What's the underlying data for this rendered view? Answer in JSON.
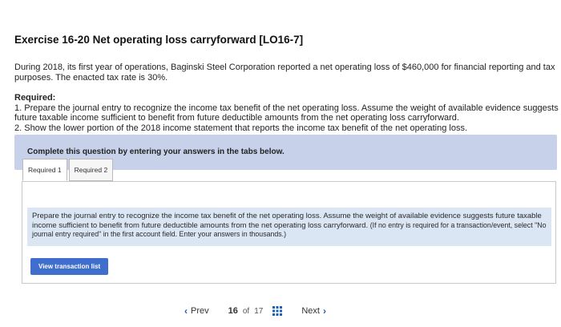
{
  "exercise": {
    "title": "Exercise 16-20 Net operating loss carryforward [LO16-7]",
    "intro": "During 2018, its first year of operations, Baginski Steel Corporation reported a net operating loss of $460,000 for financial reporting and tax purposes. The enacted tax rate is 30%.",
    "required_label": "Required:",
    "requirement_1": "1. Prepare the journal entry to recognize the income tax benefit of the net operating loss. Assume the weight of available evidence suggests future taxable income sufficient to benefit from future deductible amounts from the net operating loss carryforward.",
    "requirement_2": "2. Show the lower portion of the 2018 income statement that reports the income tax benefit of the net operating loss."
  },
  "banner": {
    "text": "Complete this question by entering your answers in the tabs below."
  },
  "tabs": [
    {
      "label": "Required 1",
      "active": true
    },
    {
      "label": "Required 2",
      "active": false
    }
  ],
  "instruction": {
    "text": "Prepare the journal entry to recognize the income tax benefit of the net operating loss. Assume the weight of available evidence suggests future taxable income sufficient to benefit from future deductible amounts from the net operating loss carryforward.",
    "hint": "(If no entry is required for a transaction/event, select \"No journal entry required\" in the first account field. Enter your answers in thousands.)"
  },
  "view_transaction_button": "View transaction list",
  "pager": {
    "prev_label": "Prev",
    "current_page": "16",
    "of_label": "of",
    "total_pages": "17",
    "next_label": "Next"
  },
  "colors": {
    "banner_bg": "#c7d2ea",
    "instruction_bg": "#dbe6f4",
    "button_bg": "#3f6ecf",
    "chevron": "#1f5fb8"
  }
}
